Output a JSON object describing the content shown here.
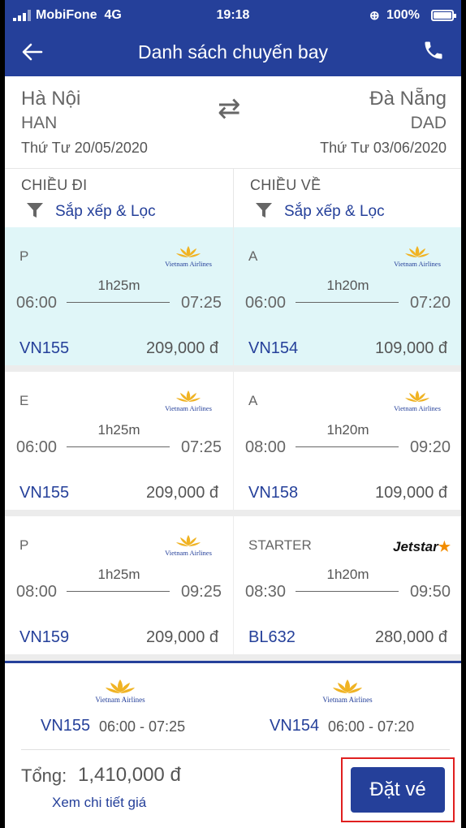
{
  "status": {
    "carrier": "MobiFone",
    "network": "4G",
    "time": "19:18",
    "battery": "100%"
  },
  "header": {
    "title": "Danh sách chuyến bay"
  },
  "route": {
    "from_city": "Hà Nội",
    "from_code": "HAN",
    "from_date": "Thứ Tư 20/05/2020",
    "to_city": "Đà Nẵng",
    "to_code": "DAD",
    "to_date": "Thứ Tư 03/06/2020",
    "swap_icon": "⇄"
  },
  "directions": {
    "outbound": {
      "label": "CHIỀU ĐI",
      "sort": "Sắp xếp & Lọc"
    },
    "return": {
      "label": "CHIỀU VỀ",
      "sort": "Sắp xếp & Lọc"
    }
  },
  "outbound_flights": [
    {
      "fare": "P",
      "airline": "Vietnam Airlines",
      "duration": "1h25m",
      "dep": "06:00",
      "arr": "07:25",
      "flight": "VN155",
      "price": "209,000 đ",
      "selected": true
    },
    {
      "fare": "E",
      "airline": "Vietnam Airlines",
      "duration": "1h25m",
      "dep": "06:00",
      "arr": "07:25",
      "flight": "VN155",
      "price": "209,000 đ",
      "selected": false
    },
    {
      "fare": "P",
      "airline": "Vietnam Airlines",
      "duration": "1h25m",
      "dep": "08:00",
      "arr": "09:25",
      "flight": "VN159",
      "price": "209,000 đ",
      "selected": false
    }
  ],
  "return_flights": [
    {
      "fare": "A",
      "airline": "Vietnam Airlines",
      "duration": "1h20m",
      "dep": "06:00",
      "arr": "07:20",
      "flight": "VN154",
      "price": "109,000 đ",
      "selected": true
    },
    {
      "fare": "A",
      "airline": "Vietnam Airlines",
      "duration": "1h20m",
      "dep": "08:00",
      "arr": "09:20",
      "flight": "VN158",
      "price": "109,000 đ",
      "selected": false
    },
    {
      "fare": "STARTER",
      "airline": "Jetstar",
      "duration": "1h20m",
      "dep": "08:30",
      "arr": "09:50",
      "flight": "BL632",
      "price": "280,000 đ",
      "selected": false
    }
  ],
  "summary": {
    "out_airline": "Vietnam Airlines",
    "out_flight": "VN155",
    "out_time": "06:00 - 07:25",
    "ret_airline": "Vietnam Airlines",
    "ret_flight": "VN154",
    "ret_time": "06:00 - 07:20",
    "total_label": "Tổng:",
    "total_value": "1,410,000 đ",
    "detail_link": "Xem chi tiết giá",
    "book_button": "Đặt vé"
  },
  "colors": {
    "brand": "#25409a",
    "selected_bg": "#e0f6f8",
    "highlight": "#e02020",
    "jetstar": "#f28c00",
    "lotus": "#f0b323"
  }
}
